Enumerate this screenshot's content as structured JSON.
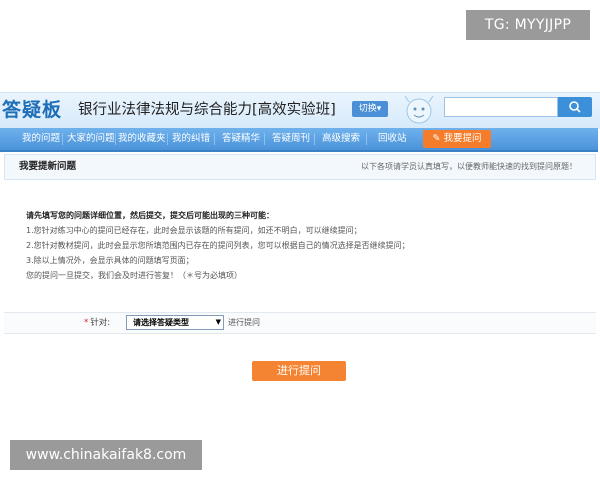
{
  "overlay": {
    "tg_label": "TG: MYYJJPP",
    "watermark": "www.chinakaifak8.com"
  },
  "header": {
    "logo": "答疑板",
    "course_title": "银行业法律法规与综合能力[高效实验班]",
    "switch_label": "切换▾",
    "search_placeholder": ""
  },
  "nav": {
    "items": [
      "我的问题",
      "大家的问题",
      "我的收藏夹",
      "我的纠错",
      "答疑精华",
      "答疑周刊",
      "高级搜索",
      "回收站"
    ],
    "ask_label": "我要提问"
  },
  "section": {
    "title": "我要提新问题",
    "hint": "以下各项请学员认真填写，以便教师能快速的找到提问原题！"
  },
  "instructions": {
    "lead": "请先填写您的问题详细位置，然后提交，提交后可能出现的三种可能：",
    "lines": [
      "1.您针对练习中心的提问已经存在，此时会显示该题的所有提问，如还不明白，可以继续提问；",
      "2.您针对教材提问，此时会显示您所填范围内已存在的提问列表，您可以根据自己的情况选择是否继续提问；",
      "3.除以上情况外，会显示具体的问题填写页面；",
      "您的提问一旦提交，我们会及时进行答复！（＊号为必填项）"
    ]
  },
  "form": {
    "required_mark": "*",
    "target_label": "针对:",
    "type_select_value": "请选择答疑类型",
    "select_suffix": "进行提问"
  },
  "submit_label": "进行提问",
  "colors": {
    "brand_blue": "#4b93da",
    "accent_orange": "#f58432"
  }
}
